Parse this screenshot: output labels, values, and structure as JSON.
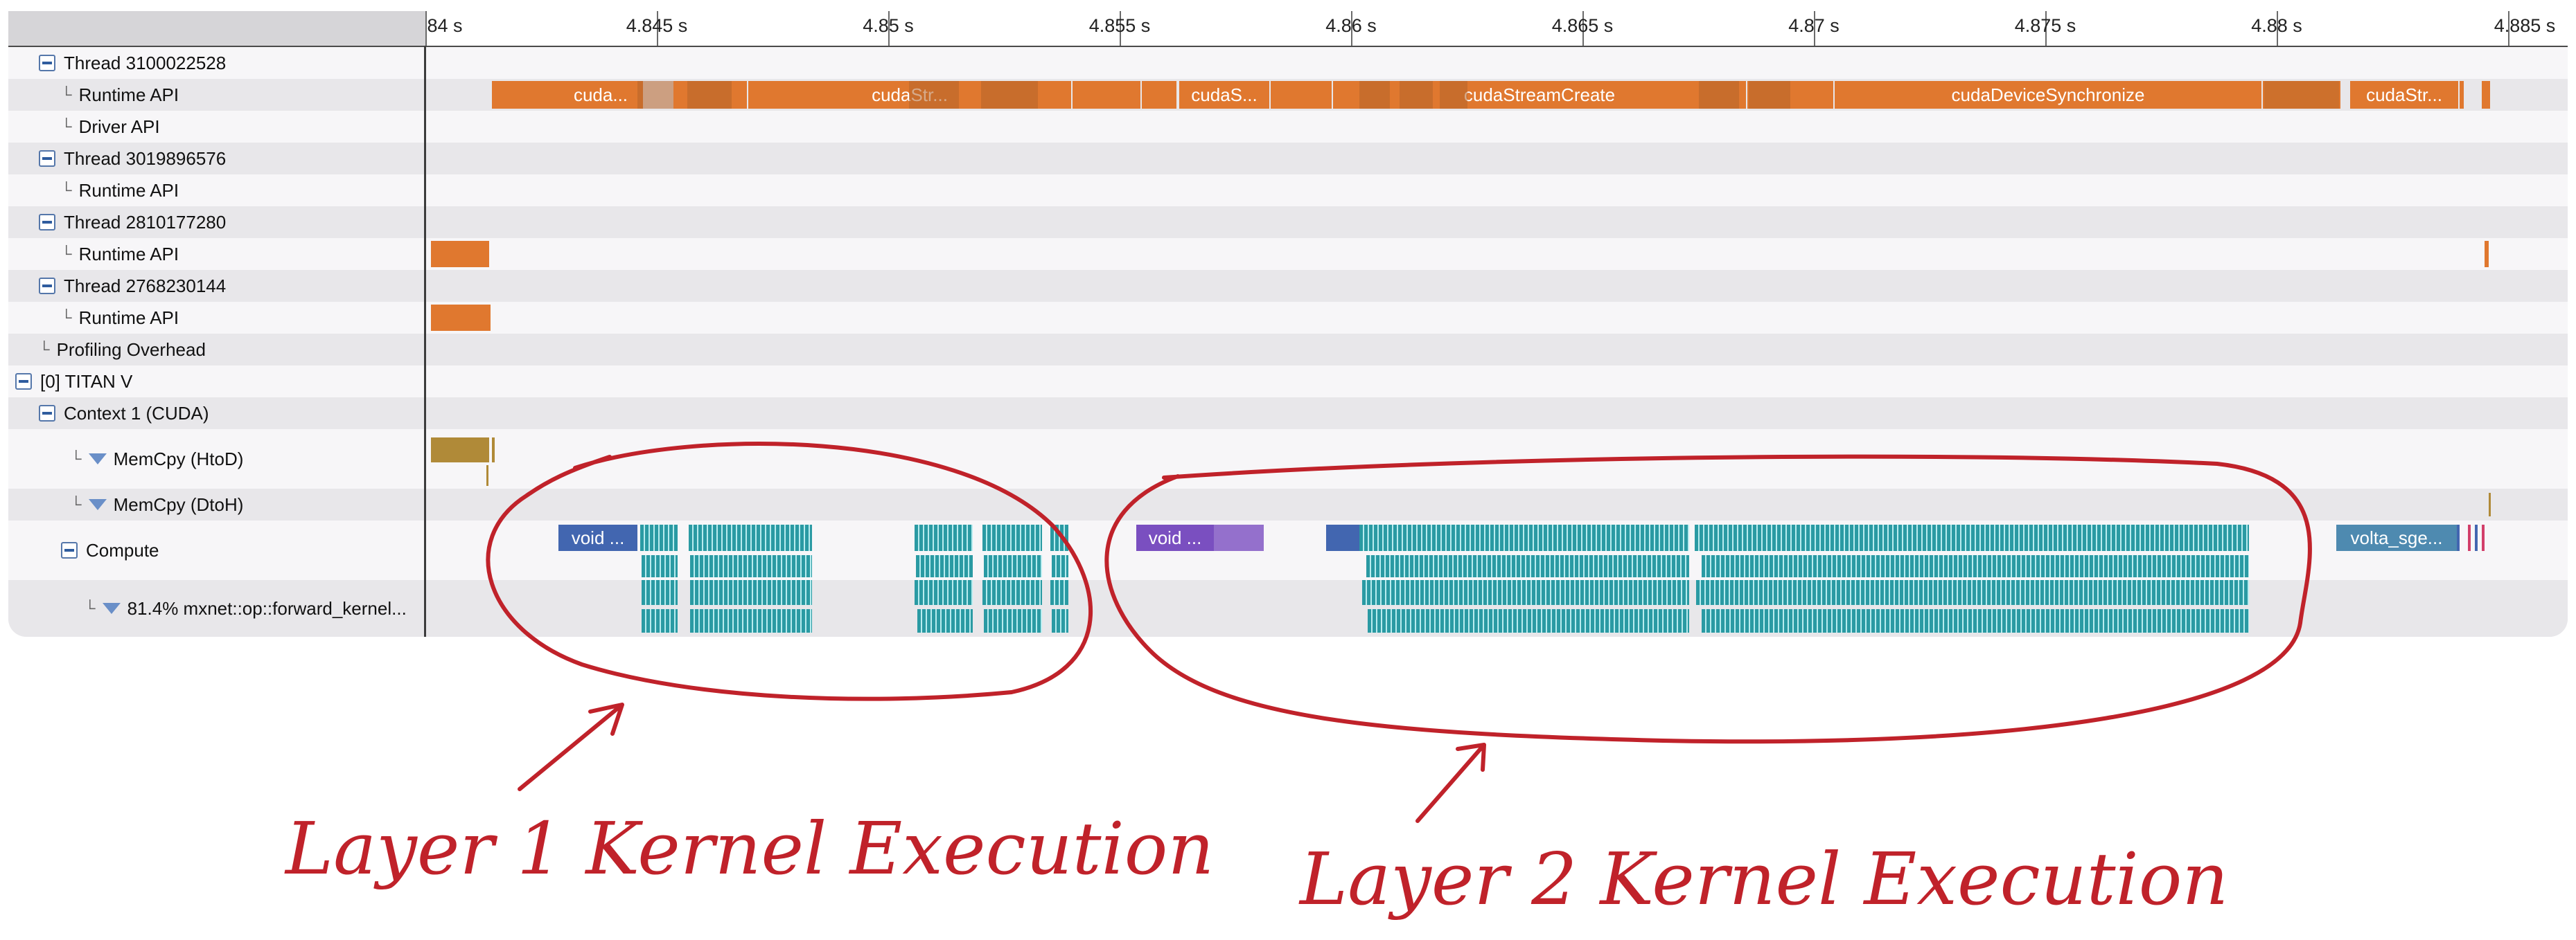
{
  "ruler": {
    "ticks": [
      "84 s",
      "4.845 s",
      "4.85 s",
      "4.855 s",
      "4.86 s",
      "4.865 s",
      "4.87 s",
      "4.875 s",
      "4.88 s",
      "4.885 s"
    ]
  },
  "rows": [
    {
      "label": "Thread 3100022528"
    },
    {
      "label": "Runtime API"
    },
    {
      "label": "Driver API"
    },
    {
      "label": "Thread 3019896576"
    },
    {
      "label": "Runtime API"
    },
    {
      "label": "Thread 2810177280"
    },
    {
      "label": "Runtime API"
    },
    {
      "label": "Thread 2768230144"
    },
    {
      "label": "Runtime API"
    },
    {
      "label": "Profiling Overhead"
    },
    {
      "label": "[0] TITAN V"
    },
    {
      "label": "Context 1 (CUDA)"
    },
    {
      "label": "MemCpy (HtoD)"
    },
    {
      "label": "MemCpy (DtoH)"
    },
    {
      "label": "Compute"
    },
    {
      "label": "81.4% mxnet::op::forward_kernel..."
    }
  ],
  "blocks": {
    "cuda_1": "cuda...",
    "cuda_str_1": "cudaStr...",
    "cuda_s": "cudaS...",
    "stream_create": "cudaStreamCreate",
    "device_sync": "cudaDeviceSynchronize",
    "cuda_str_2": "cudaStr...",
    "void_1": "void ...",
    "void_2": "void ...",
    "volta": "volta_sge..."
  },
  "annotations": {
    "layer1": "Layer 1 Kernel Execution",
    "layer2": "Layer 2 Kernel Execution"
  },
  "colors": {
    "runtime_api": "#e0782f",
    "kernel": "#2a9aa3",
    "annotation": "#c0222a"
  }
}
